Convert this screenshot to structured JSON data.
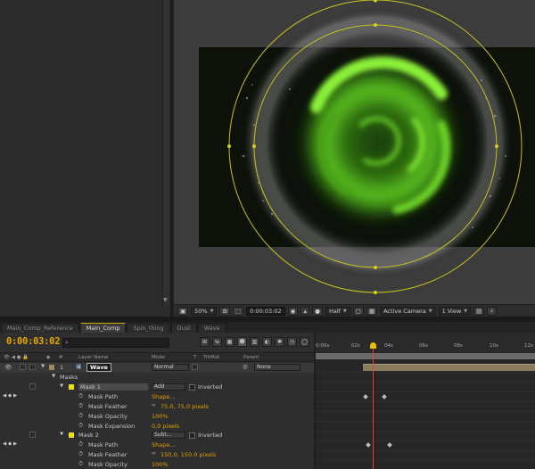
{
  "tabs": [
    "Main_Comp_Reference",
    "Main_Comp",
    "Spin_thing",
    "Dust",
    "Wave"
  ],
  "active_tab": "Main_Comp",
  "viewer_bar": {
    "zoom": "50%",
    "time": "0:00:03:02",
    "resolution": "Half",
    "camera": "Active Camera",
    "view": "1 View"
  },
  "timeline": {
    "timecode": "0:00:03:02",
    "search_placeholder": "",
    "columns": {
      "num": "#",
      "layer_name": "Layer Name",
      "mode": "Mode",
      "t": "T",
      "trkmat": "TrkMat",
      "parent": "Parent"
    },
    "ruler_labels": [
      "0:00s",
      "02s",
      "04s",
      "06s",
      "08s",
      "10s",
      "12s"
    ],
    "layer": {
      "num": "1",
      "name": "Wave",
      "mode": "Normal",
      "parent": "None"
    },
    "masks_label": "Masks",
    "mask1": {
      "name": "Mask 1",
      "mode": "Add",
      "inverted": "Inverted",
      "path_label": "Mask Path",
      "path_value": "Shape...",
      "feather_label": "Mask Feather",
      "feather_value": "75,0, 75,0 pixels",
      "opacity_label": "Mask Opacity",
      "opacity_value": "100%",
      "expansion_label": "Mask Expansion",
      "expansion_value": "0,0 pixels"
    },
    "mask2": {
      "name": "Mask 2",
      "mode": "Subt...",
      "inverted": "Inverted",
      "path_label": "Mask Path",
      "path_value": "Shape...",
      "feather_label": "Mask Feather",
      "feather_value": "150,0, 150,0 pixels",
      "opacity_label": "Mask Opacity",
      "opacity_value": "100%"
    }
  },
  "colors": {
    "accent": "#e8a800",
    "mask_stroke": "#c8c020",
    "glow": "#7adc2a",
    "label_yellow": "#f0e000"
  }
}
